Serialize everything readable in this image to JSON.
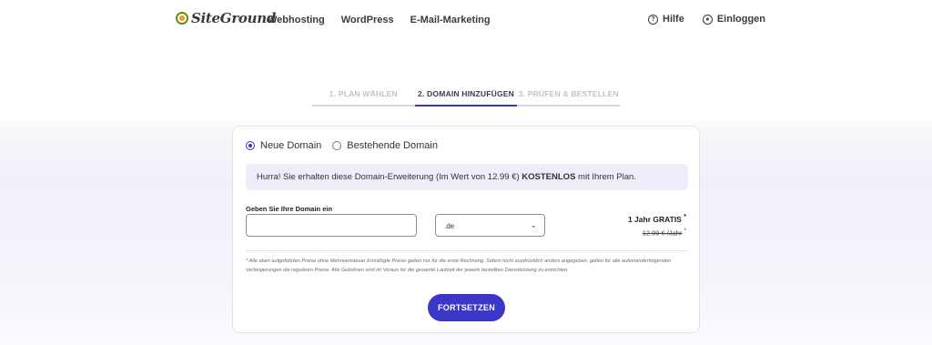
{
  "brand": {
    "logo_text": "SiteGround"
  },
  "nav": [
    "Webhosting",
    "WordPress",
    "E-Mail-Marketing"
  ],
  "header_right": {
    "help": "Hilfe",
    "login": "Einloggen"
  },
  "steps": [
    "1. PLAN WÄHLEN",
    "2. DOMAIN HINZUFÜGEN",
    "3. PRÜFEN & BESTELLEN"
  ],
  "form": {
    "radio_new": "Neue Domain",
    "radio_existing": "Bestehende Domain",
    "promo_prefix": "Hurra! Sie erhalten diese Domain-Erweiterung (Im Wert von 12.99 €) ",
    "promo_bold": "KOSTENLOS",
    "promo_suffix": " mit Ihrem Plan.",
    "domain_label": "Geben Sie Ihre Domain ein",
    "domain_value": "",
    "tld_selected": ".de",
    "price_free": "1 Jahr GRATIS",
    "price_old": "12.99 € /Jahr",
    "asterisk": "*",
    "disclaimer": "* Alle oben aufgeführten Preise ohne Mehrwertsteuer Ermäßigte Preise gelten nur für die erste Rechnung. Sofern nicht ausdrücklich anders angegeben, gelten für alle aufeinanderfolgenden Verlängerungen die regulären Preise. Alle Gebühren sind im Voraus für die gesamte Laufzeit der jeweils bestellten Dienstleistung zu entrichten.",
    "cta": "FORTSETZEN"
  },
  "colors": {
    "accent": "#3b37c8",
    "promo_bg": "#f1ecfa"
  },
  "icons": {
    "help": "question-circle-icon",
    "login": "user-circle-icon",
    "select": "chevron-down-icon"
  }
}
